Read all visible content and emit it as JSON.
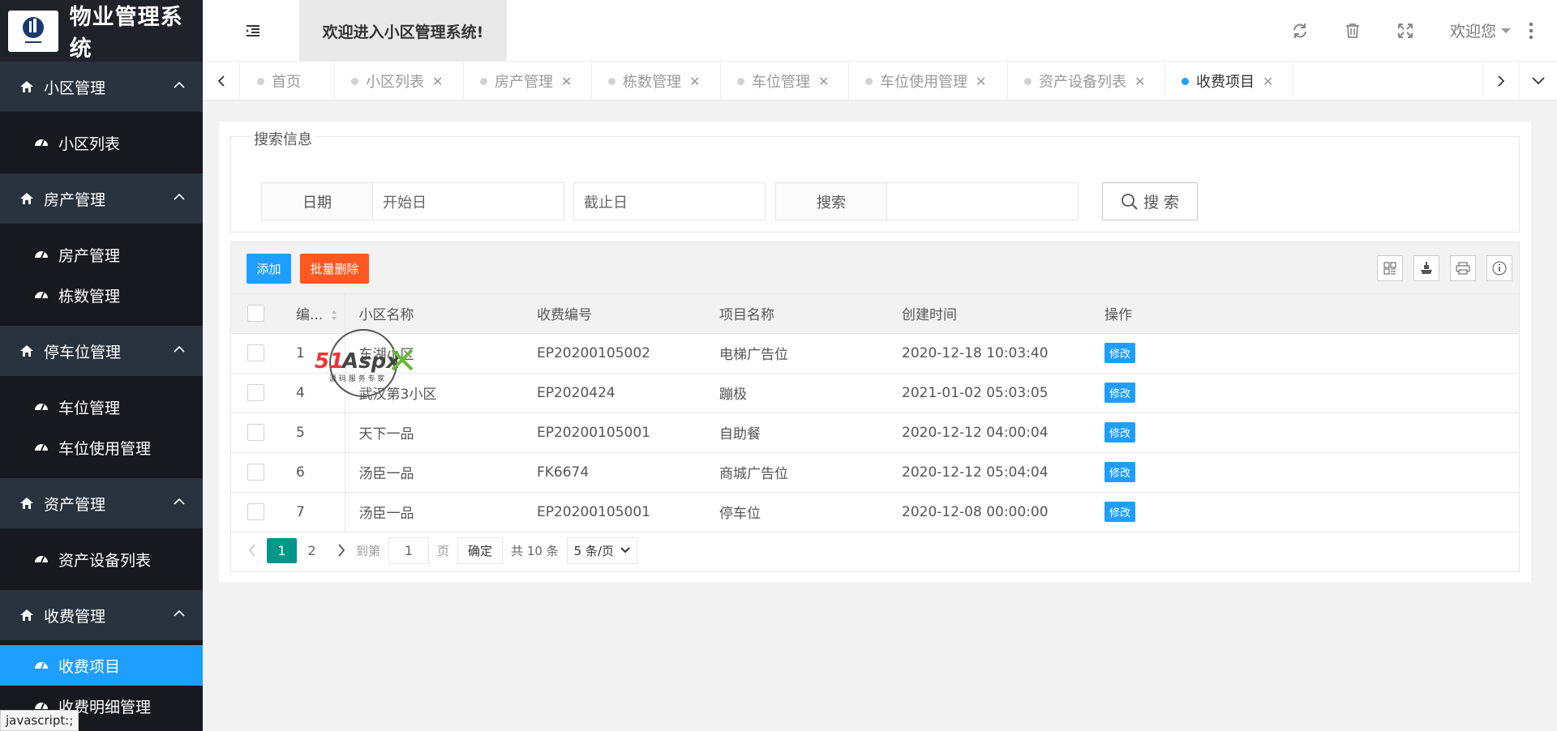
{
  "app": {
    "title": "物业管理系统"
  },
  "sidebar": {
    "groups": [
      {
        "label": "小区管理",
        "items": [
          "小区列表"
        ]
      },
      {
        "label": "房产管理",
        "items": [
          "房产管理",
          "栋数管理"
        ]
      },
      {
        "label": "停车位管理",
        "items": [
          "车位管理",
          "车位使用管理"
        ]
      },
      {
        "label": "资产管理",
        "items": [
          "资产设备列表"
        ]
      },
      {
        "label": "收费管理",
        "items": [
          "收费项目",
          "收费明细管理"
        ]
      }
    ],
    "active_item": "收费项目"
  },
  "header": {
    "welcome": "欢迎进入小区管理系统!",
    "user": "欢迎您"
  },
  "tabs": [
    "首页",
    "小区列表",
    "房产管理",
    "栋数管理",
    "车位管理",
    "车位使用管理",
    "资产设备列表",
    "收费项目"
  ],
  "search": {
    "legend": "搜索信息",
    "date_label": "日期",
    "start_placeholder": "开始日",
    "end_placeholder": "截止日",
    "keyword_label": "搜索",
    "button": "搜 索"
  },
  "toolbar": {
    "add": "添加",
    "batch_delete": "批量删除"
  },
  "table": {
    "headers": [
      "编...",
      "小区名称",
      "收费编号",
      "项目名称",
      "创建时间",
      "操作"
    ],
    "rows": [
      {
        "id": "1",
        "community": "东湖小区",
        "code": "EP20200105002",
        "item": "电梯广告位",
        "time": "2020-12-18 10:03:40",
        "action": "修改"
      },
      {
        "id": "4",
        "community": "武汉第3小区",
        "code": "EP2020424",
        "item": "蹦极",
        "time": "2021-01-02 05:03:05",
        "action": "修改"
      },
      {
        "id": "5",
        "community": "天下一品",
        "code": "EP20200105001",
        "item": "自助餐",
        "time": "2020-12-12 04:00:04",
        "action": "修改"
      },
      {
        "id": "6",
        "community": "汤臣一品",
        "code": "FK6674",
        "item": "商城广告位",
        "time": "2020-12-12 05:04:04",
        "action": "修改"
      },
      {
        "id": "7",
        "community": "汤臣一品",
        "code": "EP20200105001",
        "item": "停车位",
        "time": "2020-12-08 00:00:00",
        "action": "修改"
      }
    ]
  },
  "pager": {
    "pages": [
      "1",
      "2"
    ],
    "goto_label": "到第",
    "goto_value": "1",
    "page_unit": "页",
    "confirm": "确定",
    "total": "共 10 条",
    "per_page": "5 条/页"
  },
  "status_bar": "javascript:;",
  "watermark": "51Aspx",
  "colors": {
    "sidebar": "#28333e",
    "accent": "#1e9fff",
    "danger": "#ff5722",
    "pager_active": "#009688"
  }
}
